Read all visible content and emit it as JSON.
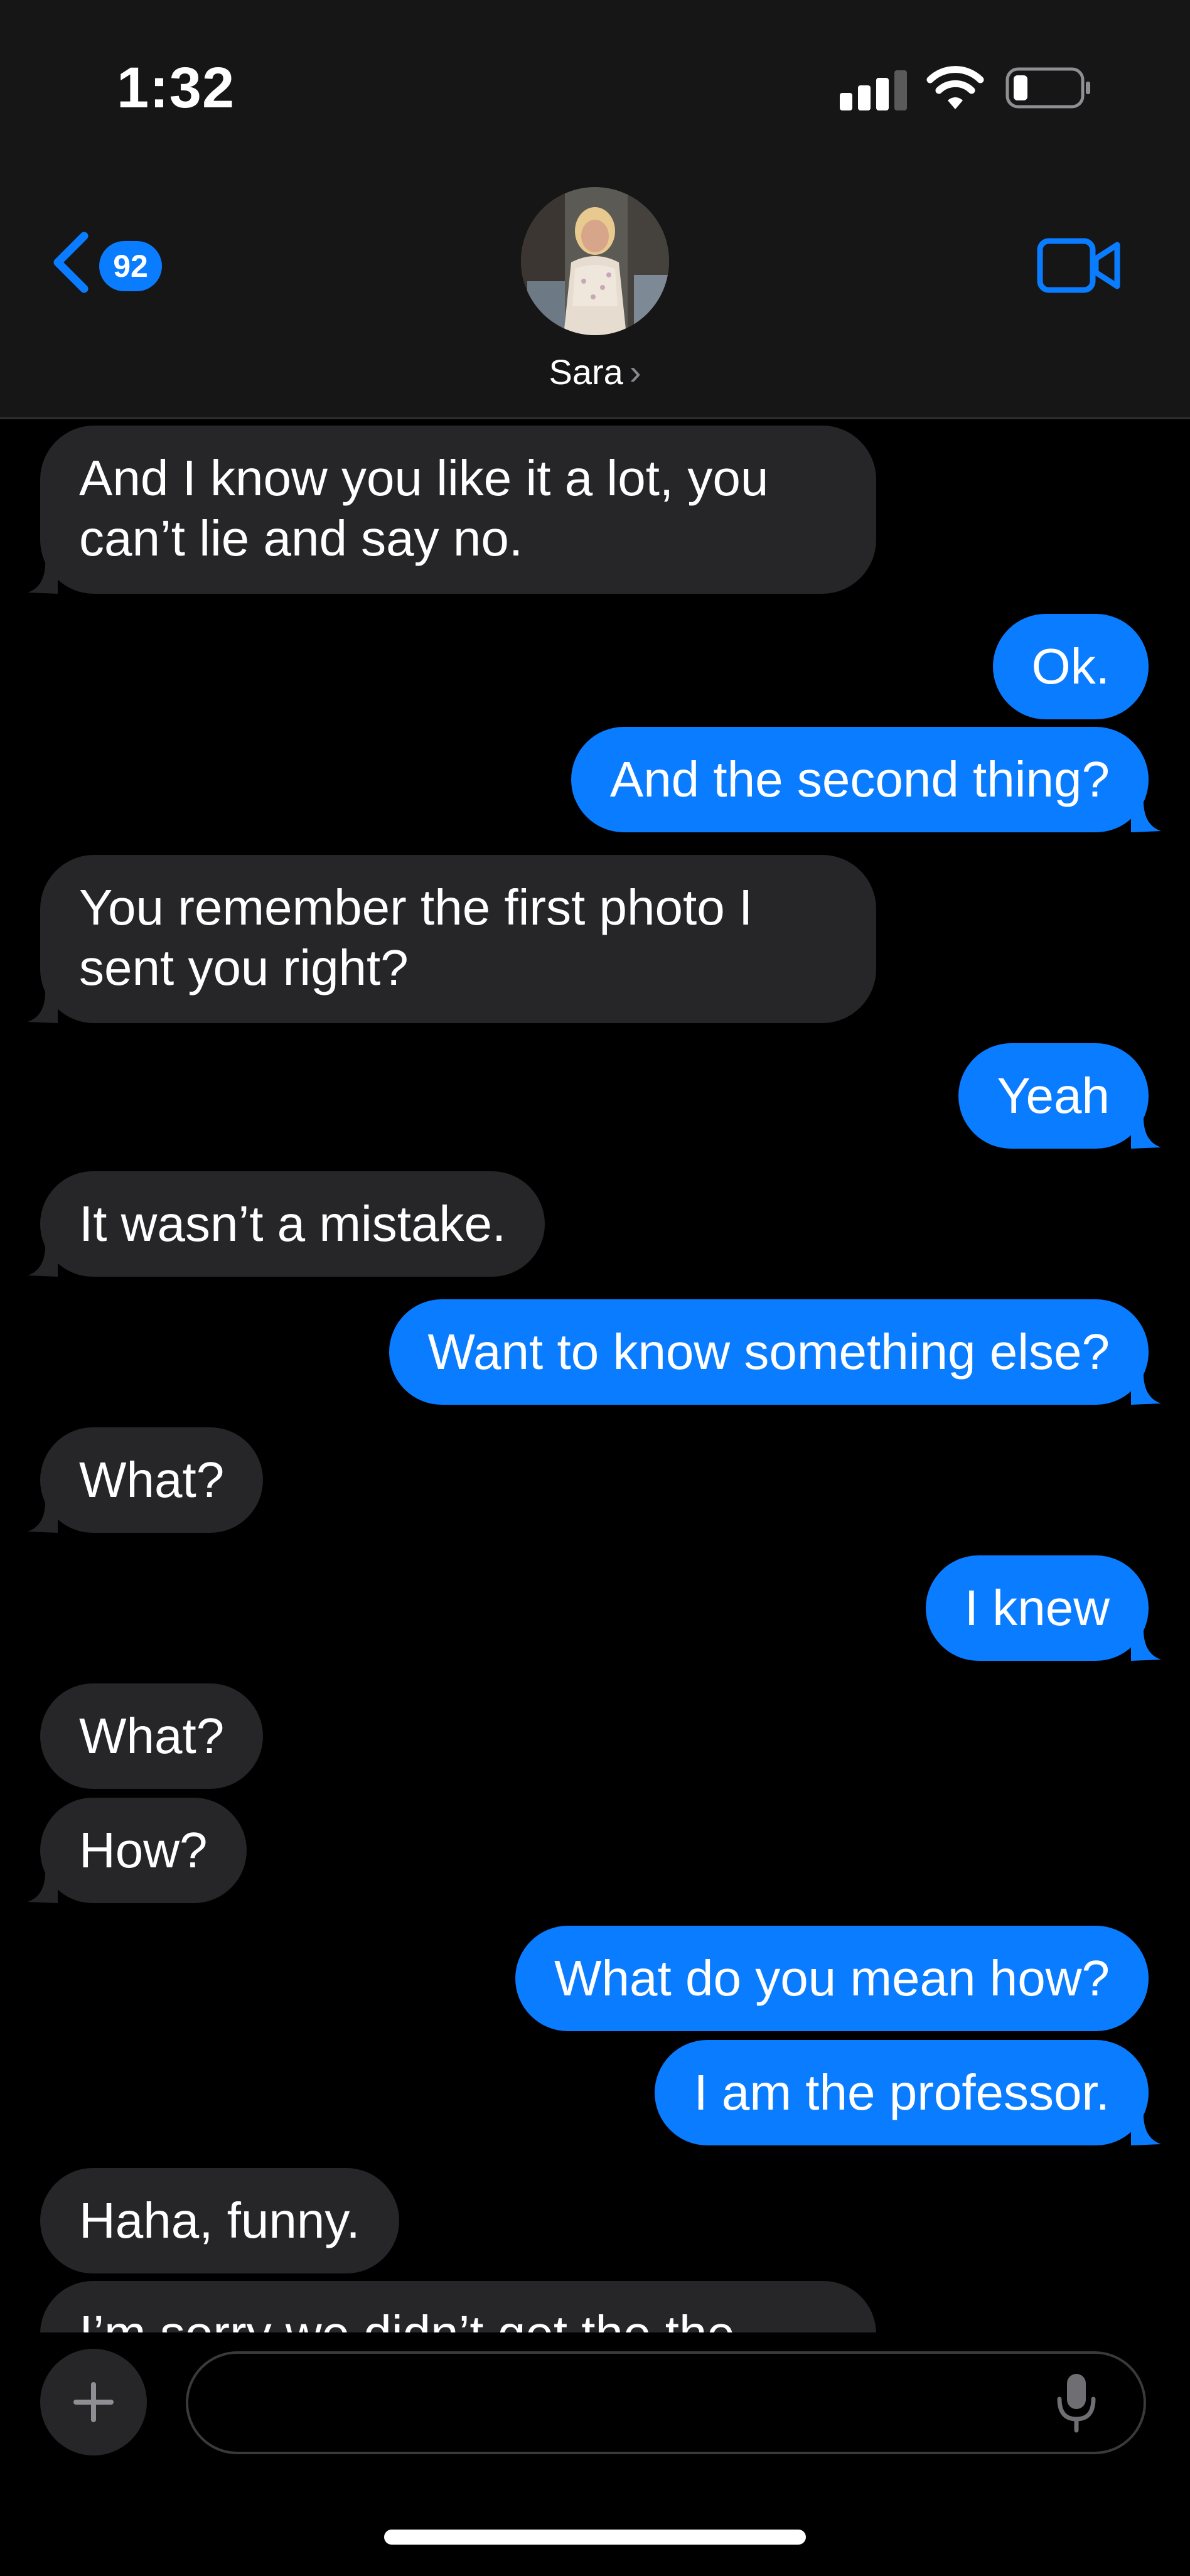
{
  "status_bar": {
    "time": "1:32",
    "icons": [
      "cellular-signal-icon",
      "wifi-icon",
      "battery-low-icon"
    ]
  },
  "header": {
    "back_badge": "92",
    "contact_name": "Sara",
    "contact_chevron": "›",
    "icons": [
      "back-chevron-icon",
      "video-camera-icon"
    ]
  },
  "messages": [
    {
      "direction": "incoming",
      "text": "And I know you like it a lot, you can’t lie and say no."
    },
    {
      "direction": "outgoing",
      "text": "Ok."
    },
    {
      "direction": "outgoing",
      "text": "And the second thing?"
    },
    {
      "direction": "incoming",
      "text": "You remember the first photo I sent you right?"
    },
    {
      "direction": "outgoing",
      "text": "Yeah"
    },
    {
      "direction": "incoming",
      "text": "It wasn’t a mistake."
    },
    {
      "direction": "outgoing",
      "text": "Want to know something else?"
    },
    {
      "direction": "incoming",
      "text": "What?"
    },
    {
      "direction": "outgoing",
      "text": "I knew"
    },
    {
      "direction": "incoming",
      "text": "What?"
    },
    {
      "direction": "incoming",
      "text": "How?"
    },
    {
      "direction": "outgoing",
      "text": "What do you mean how?"
    },
    {
      "direction": "outgoing",
      "text": "I am the professor."
    },
    {
      "direction": "incoming",
      "text": "Haha, funny."
    },
    {
      "direction": "incoming",
      "text": "I’m sorry we didn’t get the the"
    }
  ],
  "composer": {
    "value": "",
    "placeholder": "",
    "icons": [
      "plus-icon",
      "microphone-icon"
    ]
  },
  "colors": {
    "incoming_bubble": "#262628",
    "outgoing_bubble": "#0a7cff",
    "header_bg": "#161616",
    "accent": "#0a7cff"
  }
}
